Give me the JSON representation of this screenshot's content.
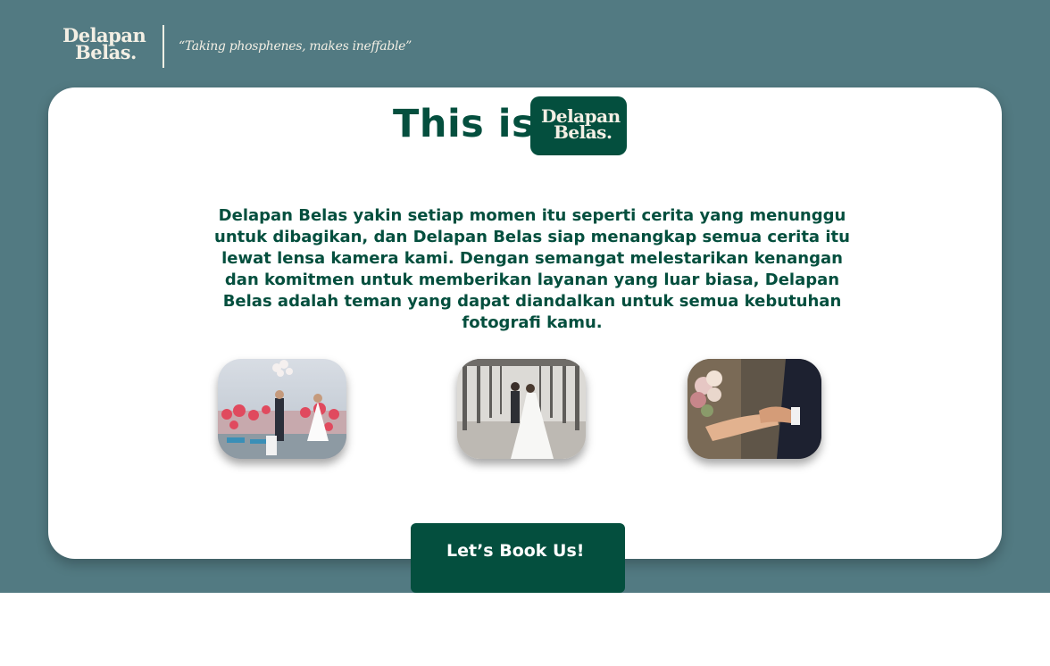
{
  "brand": {
    "logo_line1": "Delapan",
    "logo_line2": "Belas.",
    "tagline": "“Taking phosphenes, makes ineffable”"
  },
  "hero": {
    "title": "This is",
    "badge_logo_line1": "Delapan",
    "badge_logo_line2": "Belas."
  },
  "description": "Delapan Belas yakin setiap momen itu seperti cerita yang menunggu untuk dibagikan, dan Delapan Belas siap menangkap semua cerita itu lewat lensa kamera kami. Dengan semangat melestarikan kenangan dan komitmen untuk memberikan layanan yang luar biasa, Delapan Belas adalah teman yang dapat diandalkan untuk semua kebutuhan fotografi kamu.",
  "gallery": [
    "wedding-balloons-photo",
    "wedding-bridge-photo",
    "wedding-hands-photo"
  ],
  "cta": {
    "label": "Let’s Book Us!"
  },
  "colors": {
    "band": "#527a82",
    "primary": "#044f3e",
    "cream": "#f3efe4",
    "card": "#ffffff"
  }
}
